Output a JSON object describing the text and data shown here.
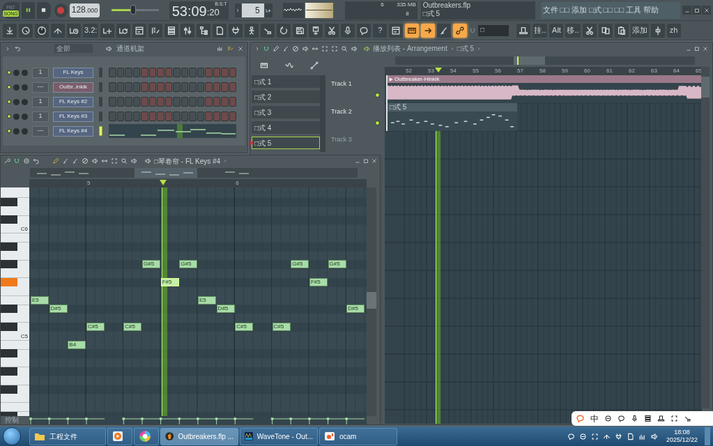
{
  "transport": {
    "modes": [
      {
        "label": "PAT",
        "selected": false
      },
      {
        "label": "SONG",
        "selected": true
      }
    ],
    "playing": true,
    "recording": false,
    "tempo_whole": "128",
    "tempo_fraction": ".000",
    "master_volume": {
      "level": 0.45
    },
    "time_main": "53:09",
    "time_ticks": ":20",
    "time_format": "B:S:T",
    "pattern": "5",
    "cpu": "6",
    "memory": "335 MB",
    "polyphony": "8"
  },
  "hint": {
    "file": "Outbreakers.flp",
    "pattern": "□式 5"
  },
  "menu": [
    "文件",
    "□□",
    "添加",
    "□式",
    "□□",
    "□□",
    "工具",
    "帮助"
  ],
  "toolbar": [
    {
      "kind": "icon",
      "on": false
    },
    {
      "kind": "icon",
      "on": false
    },
    {
      "kind": "icon",
      "on": false
    },
    {
      "kind": "icon",
      "on": false
    },
    {
      "kind": "icon",
      "on": false
    },
    {
      "kind": "text",
      "label": "3.2:",
      "on": false
    },
    {
      "kind": "icon",
      "on": false
    },
    {
      "kind": "icon",
      "on": false
    },
    {
      "kind": "icon",
      "on": false
    },
    {
      "kind": "icon",
      "on": false
    },
    {
      "kind": "icon",
      "on": false
    },
    {
      "kind": "icon",
      "on": false
    },
    {
      "kind": "icon",
      "on": false
    },
    {
      "kind": "icon",
      "on": false
    },
    {
      "kind": "icon",
      "on": false
    },
    {
      "kind": "icon",
      "on": false
    },
    {
      "kind": "icon",
      "on": false
    },
    {
      "kind": "icon",
      "on": false
    },
    {
      "kind": "icon",
      "on": false
    },
    {
      "kind": "icon",
      "on": false
    },
    {
      "kind": "icon",
      "on": false
    },
    {
      "kind": "icon",
      "on": false
    },
    {
      "kind": "icon",
      "on": false
    },
    {
      "kind": "text",
      "label": "?",
      "on": false
    },
    {
      "kind": "icon",
      "on": false
    },
    {
      "kind": "icon",
      "on": true
    },
    {
      "kind": "icon",
      "on": true
    },
    {
      "kind": "icon",
      "on": false
    },
    {
      "kind": "icon",
      "on": true
    },
    {
      "kind": "dropdown",
      "label": "□",
      "on": false
    },
    {
      "kind": "icon",
      "on": false
    },
    {
      "kind": "text",
      "label": "挂..",
      "on": false
    },
    {
      "kind": "text",
      "label": "Alt",
      "on": false
    },
    {
      "kind": "text",
      "label": "移..",
      "on": false
    },
    {
      "kind": "icon",
      "on": false
    },
    {
      "kind": "icon",
      "on": false
    },
    {
      "kind": "icon",
      "on": false
    },
    {
      "kind": "text",
      "label": "添加",
      "on": false
    },
    {
      "kind": "icon",
      "on": false
    },
    {
      "kind": "text",
      "label": "zh",
      "on": false
    }
  ],
  "channel_rack": {
    "filter": "全部",
    "title": "通道机架",
    "channels": [
      {
        "name": "FL Keys",
        "mixer_track": "1",
        "color": "#566680",
        "kind": "steps",
        "selected": false
      },
      {
        "name": "Outbr..inkik",
        "mixer_track": "---",
        "color": "#7a5c6a",
        "kind": "steps",
        "selected": false
      },
      {
        "name": "FL Keys #2",
        "mixer_track": "1",
        "color": "#566680",
        "kind": "steps",
        "selected": false
      },
      {
        "name": "FL Keys #3",
        "mixer_track": "1",
        "color": "#566680",
        "kind": "steps",
        "selected": false
      },
      {
        "name": "FL Keys #4",
        "mixer_track": "---",
        "color": "#566680",
        "kind": "preview",
        "selected": true
      }
    ]
  },
  "playlist": {
    "title": "播放列表 - Arrangement",
    "pattern": "□式 5",
    "playhead": {
      "level": 0.17
    },
    "patterns": [
      {
        "label": "□式 1",
        "selected": false
      },
      {
        "label": "□式 2",
        "selected": false
      },
      {
        "label": "□式 3",
        "selected": false
      },
      {
        "label": "□式 4",
        "selected": false
      },
      {
        "label": "□式 5",
        "selected": true
      }
    ],
    "ruler": [
      "52",
      "53",
      "54",
      "55",
      "56",
      "57",
      "58",
      "59",
      "60",
      "61",
      "62",
      "63",
      "64",
      "65"
    ],
    "tracks": [
      {
        "name": "Track 1",
        "faded": false
      },
      {
        "name": "Track 2",
        "faded": false
      },
      {
        "name": "Track 3",
        "faded": true
      }
    ],
    "clips": [
      {
        "kind": "audio",
        "label": "Outbreaker-Hinkik"
      },
      {
        "kind": "pattern",
        "label": "□式 5"
      }
    ]
  },
  "piano_roll": {
    "title": "□琴卷帘 - FL Keys #4",
    "ruler": [
      "5",
      "6"
    ],
    "playhead": {
      "level": 0.397
    },
    "key_labels": [
      "C6",
      "C5"
    ],
    "lane_label": "控制",
    "notes": [
      {
        "kind": "note",
        "label": "E5",
        "playing": false
      },
      {
        "kind": "note",
        "label": "D#5",
        "playing": false
      },
      {
        "kind": "note",
        "label": "B4",
        "playing": false
      },
      {
        "kind": "note",
        "label": "C#5",
        "playing": false
      },
      {
        "kind": "rest"
      },
      {
        "kind": "note",
        "label": "C#5",
        "playing": false
      },
      {
        "kind": "note",
        "label": "G#5",
        "playing": false
      },
      {
        "kind": "note",
        "label": "F#5",
        "playing": true
      },
      {
        "kind": "note",
        "label": "G#5",
        "playing": false
      },
      {
        "kind": "note",
        "label": "E5",
        "playing": false
      },
      {
        "kind": "note",
        "label": "D#5",
        "playing": false
      },
      {
        "kind": "note",
        "label": "C#5",
        "playing": false
      },
      {
        "kind": "rest"
      },
      {
        "kind": "note",
        "label": "C#5",
        "playing": false
      },
      {
        "kind": "note",
        "label": "G#5",
        "playing": false
      },
      {
        "kind": "note",
        "label": "F#5",
        "playing": false
      },
      {
        "kind": "note",
        "label": "G#5",
        "playing": false
      },
      {
        "kind": "note",
        "label": "D#5",
        "playing": false
      }
    ]
  },
  "ime": {
    "label": "中"
  },
  "taskbar": {
    "items": [
      {
        "kind": "folder",
        "label": "工程文件",
        "selected": false
      },
      {
        "kind": "player",
        "selected": false
      },
      {
        "kind": "colorwheel",
        "selected": false
      },
      {
        "kind": "fruit",
        "label": "Outbreakers.flp ...",
        "selected": true
      },
      {
        "kind": "wave",
        "label": "WaveTone - Out...",
        "selected": false
      },
      {
        "kind": "camera",
        "label": "ocam",
        "selected": false
      }
    ],
    "clock": "18:08",
    "date": "2025/12/22"
  }
}
